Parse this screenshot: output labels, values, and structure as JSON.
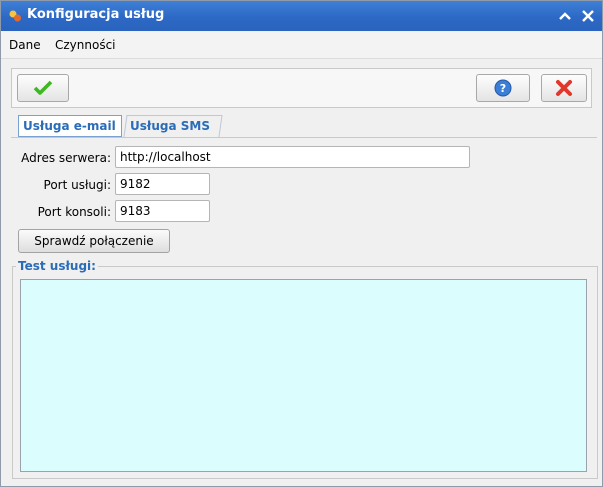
{
  "window": {
    "title": "Konfiguracja usług",
    "colors": {
      "titlebar": "#2c69c5",
      "accent_text": "#2a6cb8",
      "output_bg": "#dcfdfd"
    }
  },
  "titlebar": {
    "minimize_glyph": "⌃",
    "close_glyph": "✕",
    "icon": "app-icon"
  },
  "menu": {
    "items": [
      "Dane",
      "Czynności"
    ]
  },
  "toolbar": {
    "confirm_icon": "checkmark-icon",
    "help_icon": "help-icon",
    "cancel_icon": "close-icon"
  },
  "tabs": [
    {
      "label": "Usługa e-mail",
      "active": true
    },
    {
      "label": "Usługa SMS",
      "active": false
    }
  ],
  "form": {
    "server_label": "Adres serwera:",
    "server_value": "http://localhost",
    "port_label": "Port usługi:",
    "port_value": "9182",
    "console_label": "Port konsoli:",
    "console_value": "9183",
    "test_button": "Sprawdź połączenie"
  },
  "test_group": {
    "title": "Test usługi:",
    "output": ""
  }
}
